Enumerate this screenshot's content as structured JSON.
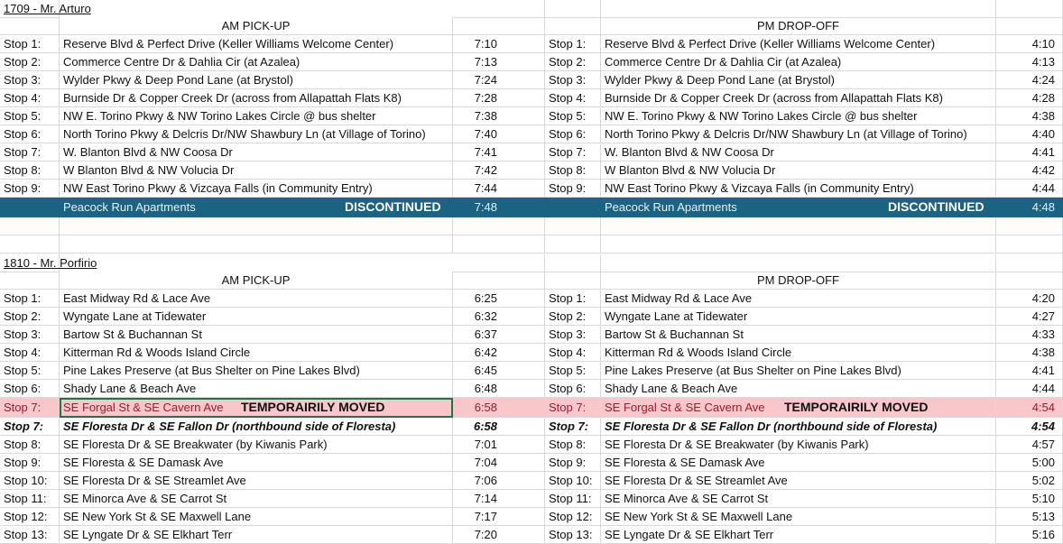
{
  "route1": {
    "title": "1709 - Mr. Arturo",
    "am_header": "AM PICK-UP",
    "pm_header": "PM DROP-OFF",
    "stops": [
      {
        "label": "Stop 1:",
        "location": "Reserve Blvd & Perfect Drive (Keller Williams Welcome Center)",
        "am": "7:10",
        "pm": "4:10"
      },
      {
        "label": "Stop 2:",
        "location": "Commerce Centre Dr & Dahlia Cir (at Azalea)",
        "am": "7:13",
        "pm": "4:13"
      },
      {
        "label": "Stop 3:",
        "location": "Wylder Pkwy & Deep Pond Lane (at Brystol)",
        "am": "7:24",
        "pm": "4:24"
      },
      {
        "label": "Stop 4:",
        "location": "Burnside Dr & Copper Creek Dr (across from Allapattah Flats K8)",
        "am": "7:28",
        "pm": "4:28"
      },
      {
        "label": "Stop 5:",
        "location": "NW E. Torino Pkwy & NW Torino Lakes Circle @ bus shelter",
        "am": "7:38",
        "pm": "4:38"
      },
      {
        "label": "Stop 6:",
        "location": "North Torino Pkwy & Delcris Dr/NW Shawbury Ln (at Village of Torino)",
        "am": "7:40",
        "pm": "4:40"
      },
      {
        "label": "Stop 7:",
        "location": "W. Blanton Blvd & NW Coosa Dr",
        "am": "7:41",
        "pm": "4:41"
      },
      {
        "label": "Stop 8:",
        "location": "W Blanton Blvd & NW Volucia Dr",
        "am": "7:42",
        "pm": "4:42"
      },
      {
        "label": "Stop 9:",
        "location": "NW East Torino Pkwy & Vizcaya Falls (in Community Entry)",
        "am": "7:44",
        "pm": "4:44"
      }
    ],
    "discontinued": {
      "location": "Peacock Run Apartments",
      "tag": "DISCONTINUED",
      "am": "7:48",
      "pm": "4:48"
    }
  },
  "route2": {
    "title": "1810 - Mr. Porfirio",
    "am_header": "AM PICK-UP",
    "pm_header": "PM DROP-OFF",
    "stops_before": [
      {
        "label": "Stop 1:",
        "location": "East Midway Rd & Lace Ave",
        "am": "6:25",
        "pm": "4:20"
      },
      {
        "label": "Stop 2:",
        "location": "Wyngate Lane at Tidewater",
        "am": "6:32",
        "pm": "4:27"
      },
      {
        "label": "Stop 3:",
        "location": "Bartow St & Buchannan St",
        "am": "6:37",
        "pm": "4:33"
      },
      {
        "label": "Stop 4:",
        "location": "Kitterman Rd & Woods Island Circle",
        "am": "6:42",
        "pm": "4:38"
      },
      {
        "label": "Stop 5:",
        "location": "Pine Lakes Preserve (at Bus Shelter on Pine Lakes Blvd)",
        "am": "6:45",
        "pm": "4:41"
      },
      {
        "label": "Stop 6:",
        "location": "Shady Lane & Beach Ave",
        "am": "6:48",
        "pm": "4:44"
      }
    ],
    "moved": {
      "label": "Stop 7:",
      "location": "SE Forgal St & SE Cavern Ave",
      "tag": "TEMPORAIRILY MOVED",
      "am": "6:58",
      "pm": "4:54"
    },
    "replacement": {
      "label": "Stop 7:",
      "location": "SE Floresta Dr & SE Fallon Dr (northbound side of Floresta)",
      "am": "6:58",
      "pm": "4:54"
    },
    "stops_after": [
      {
        "label": "Stop 8:",
        "location": "SE Floresta Dr & SE Breakwater (by Kiwanis Park)",
        "am": "7:01",
        "pm": "4:57"
      },
      {
        "label": "Stop 9:",
        "location": "SE Floresta & SE Damask Ave",
        "am": "7:04",
        "pm": "5:00"
      },
      {
        "label": "Stop 10:",
        "location": "SE Floresta Dr & SE Streamlet Ave",
        "am": "7:06",
        "pm": "5:02"
      },
      {
        "label": "Stop 11:",
        "location": "SE Minorca Ave & SE Carrot St",
        "am": "7:14",
        "pm": "5:10"
      },
      {
        "label": "Stop 12:",
        "location": "SE New York St & SE Maxwell Lane",
        "am": "7:17",
        "pm": "5:13"
      },
      {
        "label": "Stop 13:",
        "location": "SE Lyngate Dr & SE Elkhart Terr",
        "am": "7:20",
        "pm": "5:16"
      }
    ]
  },
  "colors": {
    "discontinued_bg": "#1b6382",
    "moved_bg": "#f7c7cc",
    "moved_text": "#9c1c2b",
    "selection": "#217346"
  }
}
